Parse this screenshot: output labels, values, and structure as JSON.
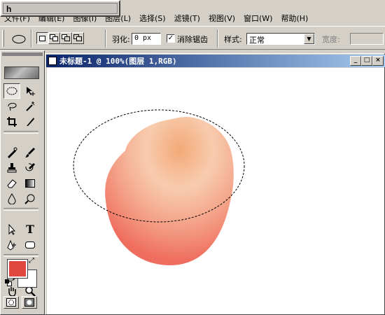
{
  "popup": {
    "text": "h"
  },
  "menu": {
    "items": [
      "文件(F)",
      "编辑(E)",
      "图像(I)",
      "图层(L)",
      "选择(S)",
      "滤镜(T)",
      "视图(V)",
      "窗口(W)",
      "帮助(H)"
    ]
  },
  "options": {
    "feather_label": "羽化:",
    "feather_value": "0 px",
    "antialias_checked": "✓",
    "antialias_label": "消除锯齿",
    "style_label": "样式:",
    "style_value": "正常",
    "width_label": "宽度:"
  },
  "document": {
    "title": "未标题-1 @ 100%(图层 1,RGB)"
  },
  "colors": {
    "foreground": "#e0473f",
    "background": "#ffffff",
    "apple_body": "#ef6d5e",
    "apple_highlight": "#f3a978"
  },
  "tools": [
    "marquee-ellipse-icon",
    "move-icon",
    "lasso-icon",
    "magic-wand-icon",
    "crop-icon",
    "slice-icon",
    "healing-brush-icon",
    "brush-icon",
    "clone-stamp-icon",
    "history-brush-icon",
    "eraser-icon",
    "gradient-icon",
    "blur-icon",
    "dodge-icon",
    "path-select-icon",
    "type-icon",
    "pen-icon",
    "shape-icon",
    "notes-icon",
    "eyedropper-icon",
    "hand-icon",
    "zoom-icon"
  ]
}
